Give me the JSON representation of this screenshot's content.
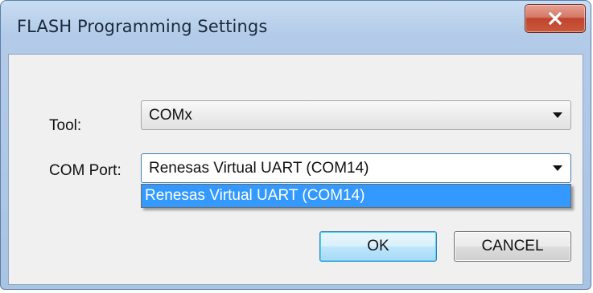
{
  "window": {
    "title": "FLASH Programming Settings"
  },
  "form": {
    "tool_label": "Tool:",
    "tool_value": "COMx",
    "com_port_label": "COM Port:",
    "com_port_value": "Renesas Virtual UART (COM14)",
    "com_port_options": [
      "Renesas Virtual UART (COM14)"
    ]
  },
  "buttons": {
    "ok_label": "OK",
    "cancel_label": "CANCEL"
  },
  "icons": {
    "close": "close-icon",
    "dropdown_arrow": "chevron-down-icon"
  },
  "colors": {
    "selection": "#3399ff",
    "close_button": "#c85a3a",
    "default_button_border": "#3c7fb1"
  }
}
